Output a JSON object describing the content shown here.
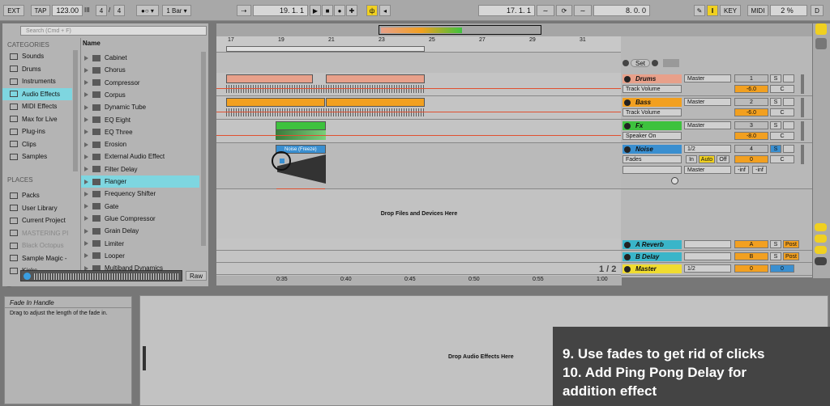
{
  "transport": {
    "ext": "EXT",
    "tap": "TAP",
    "tempo": "123.00",
    "bars_icon": "III",
    "time_sig_num": "4",
    "time_sig_den": "4",
    "metronome": "1 Bar",
    "arrangement_position": "19.  1.  1",
    "loop_start": "17.  1.  1",
    "loop_length": "8.  0.  0",
    "key": "KEY",
    "midi": "MIDI",
    "cpu": "2 %",
    "d_label": "D"
  },
  "browser": {
    "search_placeholder": "Search (Cmd + F)",
    "categories_header": "CATEGORIES",
    "categories": [
      "Sounds",
      "Drums",
      "Instruments",
      "Audio Effects",
      "MIDI Effects",
      "Max for Live",
      "Plug-ins",
      "Clips",
      "Samples"
    ],
    "places_header": "PLACES",
    "places": [
      "Packs",
      "User Library",
      "Current Project",
      "MASTERING PI",
      "Black Octopus",
      "Sample Magic -",
      "Kicks"
    ],
    "name_header": "Name",
    "files": [
      "Cabinet",
      "Chorus",
      "Compressor",
      "Corpus",
      "Dynamic Tube",
      "EQ Eight",
      "EQ Three",
      "Erosion",
      "External Audio Effect",
      "Filter Delay",
      "Flanger",
      "Frequency Shifter",
      "Gate",
      "Glue Compressor",
      "Grain Delay",
      "Limiter",
      "Looper",
      "Multiband Dynamics"
    ],
    "raw": "Raw"
  },
  "arrangement": {
    "bar_numbers": [
      "17",
      "19",
      "21",
      "23",
      "25",
      "27",
      "29",
      "31"
    ],
    "time_labels": [
      "0:35",
      "0:40",
      "0:45",
      "0:50",
      "0:55",
      "1:00"
    ],
    "noise_clip_label": "Noise (Freeze)",
    "drop_files": "Drop Files and Devices Here",
    "page_indicator": "1 / 2"
  },
  "mixer": {
    "set_label": "Set",
    "tracks": [
      {
        "name": "Drums",
        "color": "#e8a08a",
        "sub": "Track Volume",
        "out": "Master",
        "num": "1",
        "vol": "-6.0",
        "pan": "C"
      },
      {
        "name": "Bass",
        "color": "#f2a020",
        "sub": "Track Volume",
        "out": "Master",
        "num": "2",
        "vol": "-6.0",
        "pan": "C"
      },
      {
        "name": "Fx",
        "color": "#3ec23e",
        "sub": "Speaker On",
        "out": "Master",
        "num": "3",
        "vol": "-8.0",
        "pan": "C"
      },
      {
        "name": "Noise",
        "color": "#3a8fd0",
        "sub": "Fades",
        "out": "1/2",
        "num": "4",
        "vol": "0",
        "pan": "C"
      }
    ],
    "noise_in": "In",
    "noise_auto": "Auto",
    "noise_off": "Off",
    "noise_master": "Master",
    "inf1": "-inf",
    "inf2": "-inf",
    "returns": [
      {
        "name": "A Reverb",
        "color": "#3ab5c9",
        "letter": "A",
        "post": "Post"
      },
      {
        "name": "B Delay",
        "color": "#3ab5c9",
        "letter": "B",
        "post": "Post"
      }
    ],
    "master": {
      "name": "Master",
      "color": "#f0dc30",
      "out": "1/2",
      "vol": "0",
      "pan": "0"
    },
    "solo": "S"
  },
  "info": {
    "title": "Fade In Handle",
    "text": "Drag to adjust the length of the fade in."
  },
  "device": {
    "drop_effects": "Drop Audio Effects Here"
  },
  "overlay": {
    "line1": "9. Use fades to get rid of  clicks",
    "line2": "10. Add Ping Pong Delay for",
    "line3": "addition effect"
  }
}
